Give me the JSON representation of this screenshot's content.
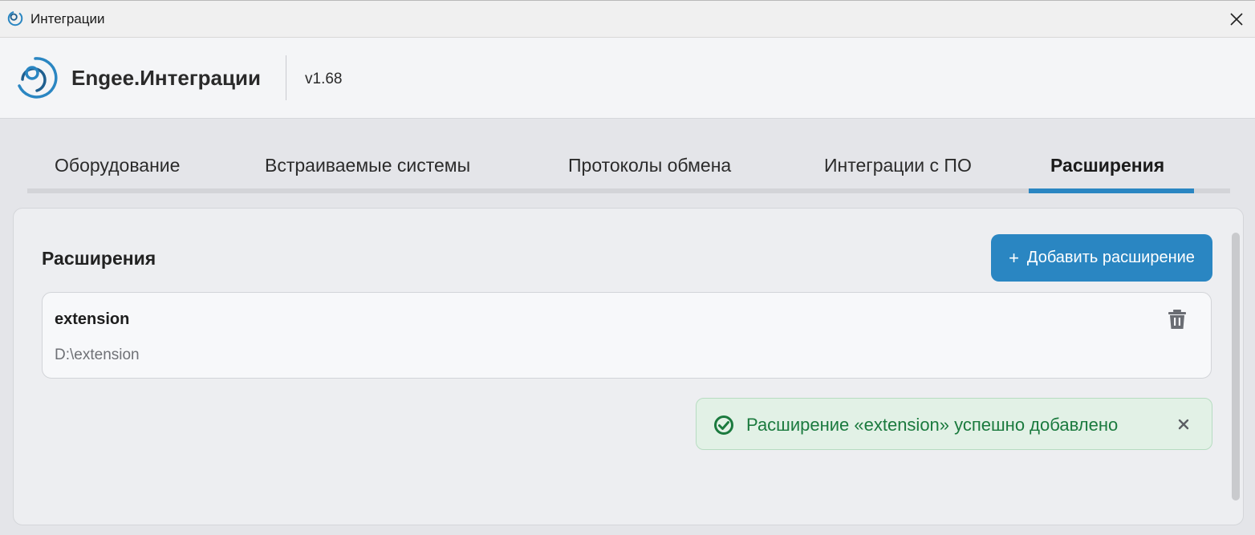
{
  "window": {
    "title": "Интеграции",
    "close_icon": "close-icon"
  },
  "header": {
    "brand": "Engee.Интеграции",
    "version": "v1.68"
  },
  "tabs": [
    {
      "label": "Оборудование",
      "active": false
    },
    {
      "label": "Встраиваемые системы",
      "active": false
    },
    {
      "label": "Протоколы обмена",
      "active": false
    },
    {
      "label": "Интеграции с ПО",
      "active": false
    },
    {
      "label": "Расширения",
      "active": true
    }
  ],
  "main": {
    "section_title": "Расширения",
    "add_button": {
      "icon": "plus",
      "label": "Добавить расширение"
    },
    "extensions": [
      {
        "name": "extension",
        "path": "D:\\extension",
        "action_icon": "trash-icon"
      }
    ],
    "toast": {
      "type": "success",
      "icon": "check-circle-icon",
      "message": "Расширение «extension» успешно добавлено",
      "close_icon": "close-icon"
    }
  },
  "colors": {
    "accent": "#2a86c2",
    "success_text": "#1b7a3e",
    "success_bg": "#e2f1e6"
  }
}
